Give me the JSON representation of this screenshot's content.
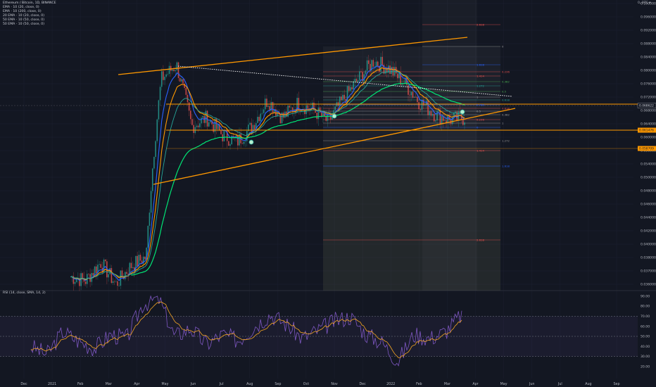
{
  "header": {
    "title": "Ethereum / Bitcoin, 1D, BINANCE",
    "indicators": [
      "EMA · 10 (20, close, 0)",
      "EMA · 10 (200, close, 0)",
      "20 EMA · 10 (20, close, 0)",
      "50 EMA · 10 (50, close, 0)",
      "50 EMA · 10 (50, close, 0)"
    ],
    "unit": "0, BTC ▾",
    "rsi_label": "RSI (14, close, SMA, 14, 2)"
  },
  "colors": {
    "background": "#131722",
    "candle_up": "#26a69a",
    "candle_down": "#ef5350",
    "trendline": "#ff9800",
    "ema_fast": "#2962ff",
    "ema_slow": "#00e676",
    "rsi": "#7e57c2",
    "rsi_ma": "#f5a623"
  },
  "chart_data": [
    {
      "type": "line",
      "x_axis_labels": [
        "Dec",
        "2021",
        "Feb",
        "Mar",
        "Apr",
        "May",
        "Jun",
        "Jul",
        "Aug",
        "Sep",
        "Oct",
        "Nov",
        "Dec",
        "2022",
        "Feb",
        "Mar",
        "Apr",
        "May",
        "Jun",
        "Jul",
        "Aug",
        "Sep"
      ],
      "y_tick_labels": [
        "0.100000",
        "0.096000",
        "0.092000",
        "0.088000",
        "0.084000",
        "0.080000",
        "0.076000",
        "0.072000",
        "0.068000",
        "0.064000",
        "0.060000",
        "0.056000",
        "0.054000",
        "0.050000",
        "0.048000",
        "0.046000",
        "0.044000",
        "0.042000",
        "0.040000",
        "0.038000",
        "0.037000",
        "0.036000"
      ],
      "price_badges": [
        "0.068622",
        "0.061476",
        "0.058709"
      ],
      "fib_levels": [
        {
          "label": "2.618",
          "color": "#ef5350"
        },
        {
          "label": "0",
          "color": "#9e9e9e"
        },
        {
          "label": "1.618",
          "color": "#2962ff"
        },
        {
          "label": "0.236",
          "color": "#ef5350"
        },
        {
          "label": "1.414",
          "color": "#ef5350"
        },
        {
          "label": "0.382",
          "color": "#4caf50"
        },
        {
          "label": "1.272",
          "color": "#26a69a"
        },
        {
          "label": "0.5",
          "color": "#4caf50"
        },
        {
          "label": "1",
          "color": "#9e9e9e"
        },
        {
          "label": "0.618",
          "color": "#26a69a"
        },
        {
          "label": "0.786",
          "color": "#2962ff"
        },
        {
          "label": "0.618",
          "color": "#ef5350"
        },
        {
          "label": "0.5",
          "color": "#9e9e9e"
        },
        {
          "label": "0.382",
          "color": "#9e9e9e"
        },
        {
          "label": "0.236",
          "color": "#ef5350"
        },
        {
          "label": "1",
          "color": "#9e9e9e"
        },
        {
          "label": "0",
          "color": "#2962ff"
        },
        {
          "label": "1.272",
          "color": "#9e9e9e"
        },
        {
          "label": "1.414",
          "color": "#ef5350"
        },
        {
          "label": "1.618",
          "color": "#2962ff"
        },
        {
          "label": "2.618",
          "color": "#ef5350"
        }
      ],
      "series": [
        {
          "values": [
            0.037,
            0.0365,
            0.039,
            0.036,
            0.0385,
            0.0398,
            0.076,
            0.08,
            0.064,
            0.066,
            0.062,
            0.0605,
            0.064,
            0.0705,
            0.066,
            0.0695,
            0.068,
            0.065,
            0.0705,
            0.076,
            0.0812,
            0.079,
            0.075,
            0.07,
            0.067,
            0.0655,
            0.066
          ]
        }
      ]
    },
    {
      "type": "line",
      "y_tick_labels": [
        "90.00",
        "80.00",
        "70.00",
        "60.00",
        "50.00",
        "40.00",
        "30.00",
        "20.00"
      ],
      "ylim": [
        15,
        92
      ],
      "bands": [
        30,
        50,
        70
      ],
      "series": [
        {
          "values": [
            40,
            32,
            55,
            45,
            38,
            52,
            48,
            82,
            88,
            50,
            58,
            42,
            52,
            46,
            60,
            72,
            62,
            48,
            56,
            65,
            70,
            52,
            44,
            25,
            52,
            48,
            55,
            72
          ]
        }
      ]
    }
  ]
}
